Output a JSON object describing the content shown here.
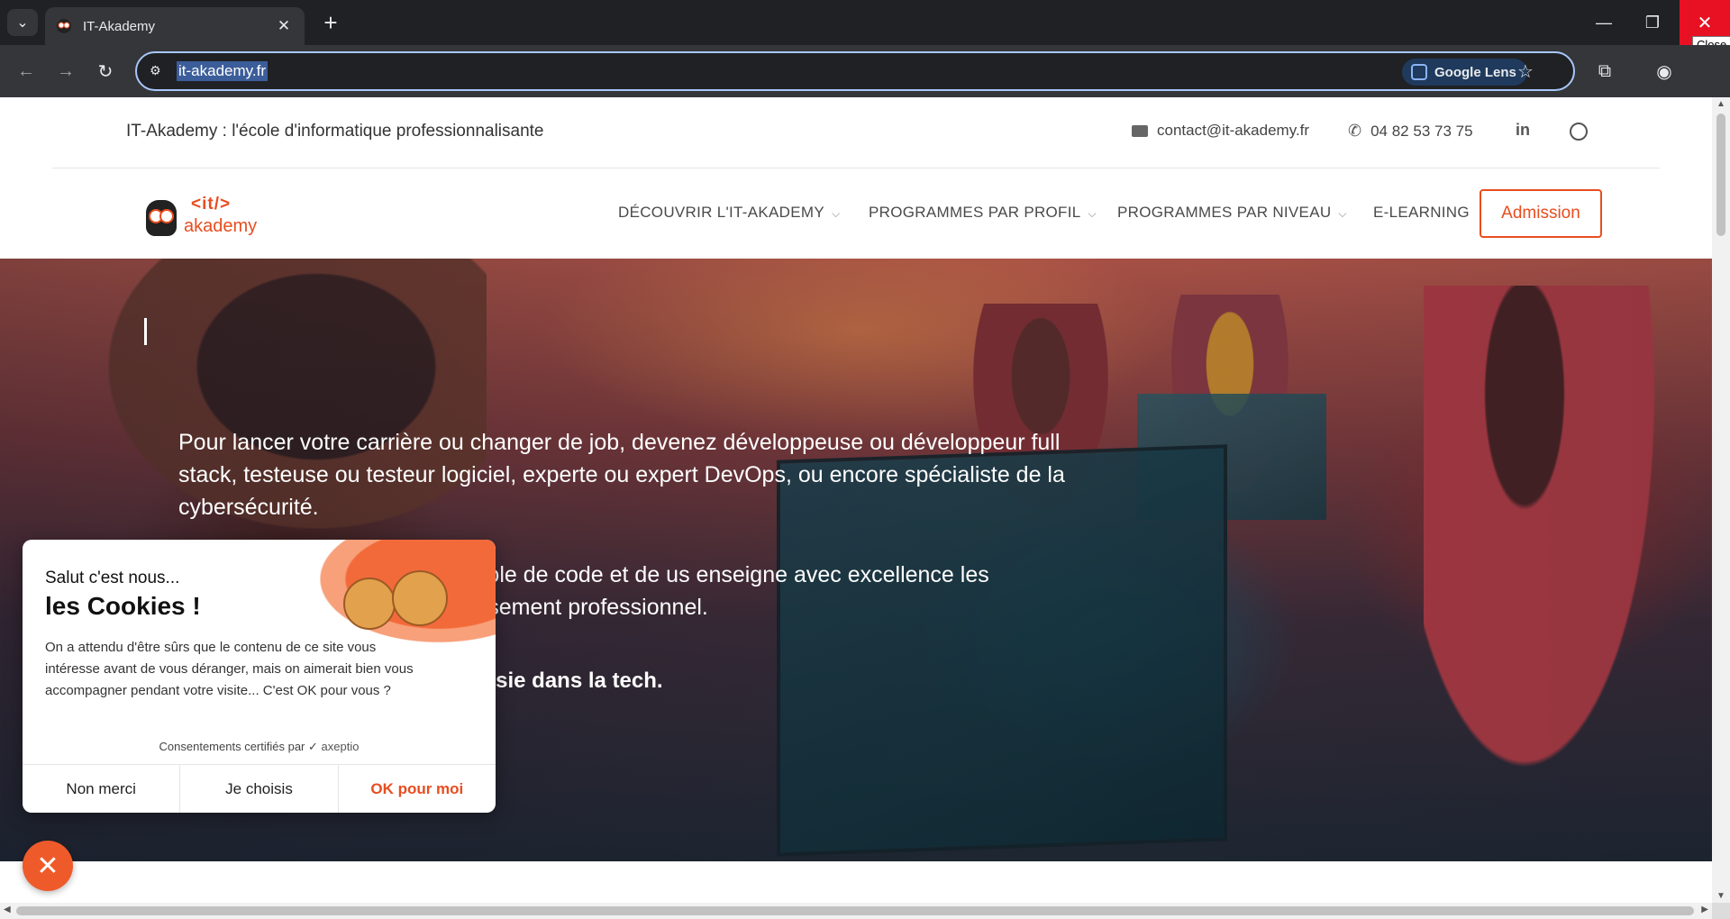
{
  "browser": {
    "tab_title": "IT-Akademy",
    "url": "it-akademy.fr",
    "lens_label": "Google Lens",
    "close_tooltip": "Close"
  },
  "topbar": {
    "tagline": "IT-Akademy : l'école d'informatique professionnalisante",
    "email": "contact@it-akademy.fr",
    "phone": "04 82 53 73 75",
    "linkedin_label": "in"
  },
  "logo": {
    "line1": "<it/>",
    "line2": "akademy"
  },
  "nav": {
    "items": [
      {
        "label": "DÉCOUVRIR L'IT-AKADEMY"
      },
      {
        "label": "PROGRAMMES PAR PROFIL"
      },
      {
        "label": "PROGRAMMES PAR NIVEAU"
      },
      {
        "label": "E-LEARNING"
      }
    ],
    "cta": "Admission"
  },
  "hero": {
    "paragraph1": "Pour lancer votre carrière ou changer de job, devenez développeuse ou développeur full stack, testeuse ou testeur logiciel, experte ou expert DevOps, ou encore spécialiste de la cybersécurité.",
    "paragraph2": "projet, métier et entreprise, l'école de code et de us enseigne avec excellence les compétences & votre épanouissement professionnel.",
    "paragraph3": "pétence pour une carrière réussie dans la tech."
  },
  "cookie": {
    "greeting": "Salut c'est nous...",
    "headline": "les Cookies !",
    "body": "On a attendu d'être sûrs que le contenu de ce site vous intéresse avant de vous déranger, mais on aimerait bien vous accompagner pendant votre visite... C'est OK pour vous ?",
    "certified": "Consentements certifiés par",
    "brand": "axeptio",
    "buttons": {
      "reject": "Non merci",
      "choose": "Je choisis",
      "accept": "OK pour moi"
    }
  }
}
